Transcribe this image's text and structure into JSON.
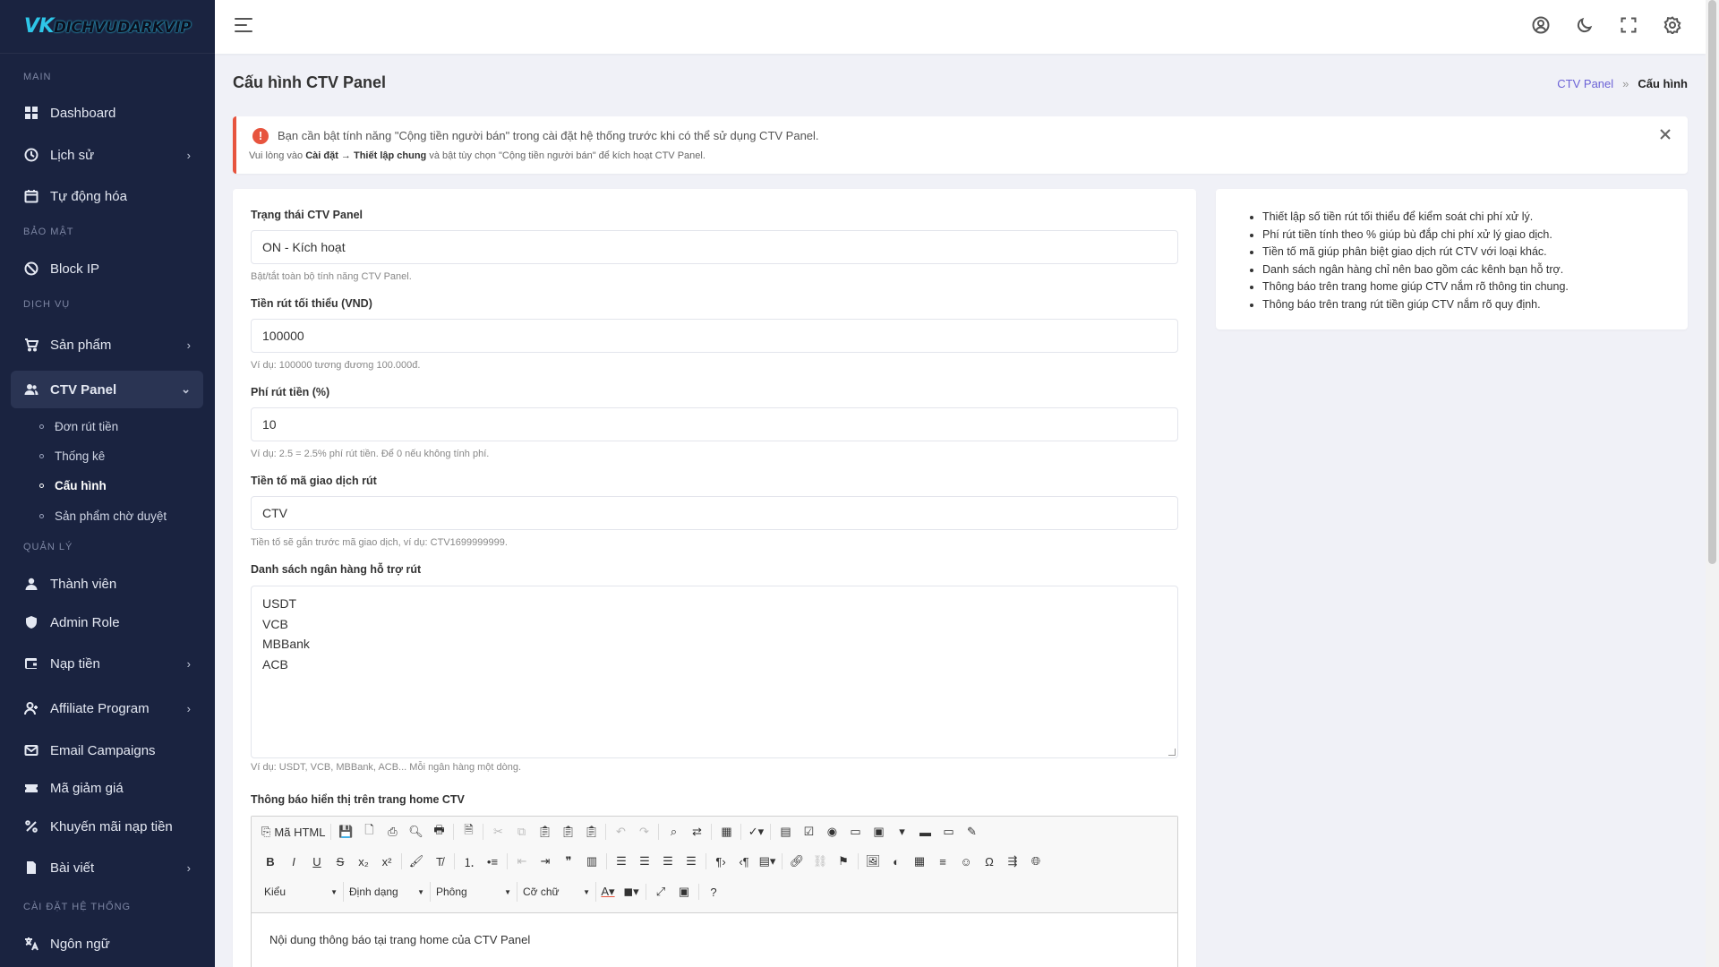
{
  "brand": {
    "logo_text": "DICHVUDARKVIP",
    "logo_mark": "VK"
  },
  "sidebar": {
    "sections": {
      "main": "MAIN",
      "security": "BẢO MẬT",
      "services": "DỊCH VỤ",
      "management": "QUẢN LÝ",
      "system": "CÀI ĐẶT HỆ THỐNG"
    },
    "items": {
      "dashboard": "Dashboard",
      "history": "Lịch sử",
      "automation": "Tự động hóa",
      "block_ip": "Block IP",
      "products": "Sản phẩm",
      "ctv_panel": "CTV Panel",
      "members": "Thành viên",
      "admin_role": "Admin Role",
      "deposit": "Nạp tiền",
      "affiliate": "Affiliate Program",
      "email": "Email Campaigns",
      "coupon": "Mã giảm giá",
      "promo": "Khuyến mãi nạp tiền",
      "posts": "Bài viết",
      "language": "Ngôn ngữ"
    },
    "ctv_sub": {
      "withdraw_orders": "Đơn rút tiền",
      "stats": "Thống kê",
      "config": "Cấu hình",
      "pending_products": "Sản phẩm chờ duyệt"
    }
  },
  "topbar": {
    "icons": [
      "menu-icon",
      "user-circle-icon",
      "moon-icon",
      "fullscreen-icon",
      "gear-icon"
    ]
  },
  "page": {
    "title": "Cấu hình CTV Panel",
    "breadcrumb": {
      "parent": "CTV Panel",
      "separator": "»",
      "current": "Cấu hình"
    }
  },
  "alert": {
    "message": "Bạn cần bật tính năng \"Cộng tiền người bán\" trong cài đặt hệ thống trước khi có thể sử dụng CTV Panel.",
    "sub_prefix": "Vui lòng vào ",
    "sub_path": "Cài đặt → Thiết lập chung",
    "sub_suffix": " và bật tùy chọn \"Cộng tiền người bán\" để kích hoạt CTV Panel.",
    "color": "#e7543e"
  },
  "form": {
    "status": {
      "label": "Trạng thái CTV Panel",
      "value": "ON - Kích hoạt",
      "help": "Bật/tắt toàn bộ tính năng CTV Panel."
    },
    "min_withdraw": {
      "label": "Tiền rút tối thiểu (VND)",
      "value": "100000",
      "help": "Ví dụ: 100000 tương đương 100.000đ."
    },
    "fee": {
      "label": "Phí rút tiền (%)",
      "value": "10",
      "help": "Ví dụ: 2.5 = 2.5% phí rút tiền. Để 0 nếu không tính phí."
    },
    "prefix": {
      "label": "Tiền tố mã giao dịch rút",
      "value": "CTV",
      "help": "Tiền tố sẽ gắn trước mã giao dịch, ví dụ: CTV1699999999."
    },
    "banks": {
      "label": "Danh sách ngân hàng hỗ trợ rút",
      "values": [
        "USDT",
        "VCB",
        "MBBank",
        "ACB"
      ],
      "help": "Ví dụ: USDT, VCB, MBBank, ACB... Mỗi ngân hàng một dòng."
    },
    "home_notice": {
      "label": "Thông báo hiển thị trên trang home CTV",
      "content": "Nội dung thông báo tại trang home của CTV Panel",
      "toolbar": {
        "source": "Mã HTML",
        "style": "Kiểu",
        "format": "Định dạng",
        "font": "Phông",
        "size": "Cỡ chữ"
      }
    }
  },
  "tips": [
    "Thiết lập số tiền rút tối thiểu để kiểm soát chi phí xử lý.",
    "Phí rút tiền tính theo % giúp bù đắp chi phí xử lý giao dịch.",
    "Tiền tố mã giúp phân biệt giao dịch rút CTV với loại khác.",
    "Danh sách ngân hàng chỉ nên bao gồm các kênh bạn hỗ trợ.",
    "Thông báo trên trang home giúp CTV nắm rõ thông tin chung.",
    "Thông báo trên trang rút tiền giúp CTV nắm rõ quy định."
  ],
  "colors": {
    "sidebar_bg": "#1a2340",
    "accent": "#6c63d6",
    "danger": "#e7543e",
    "page_bg": "#f0f1f7"
  }
}
